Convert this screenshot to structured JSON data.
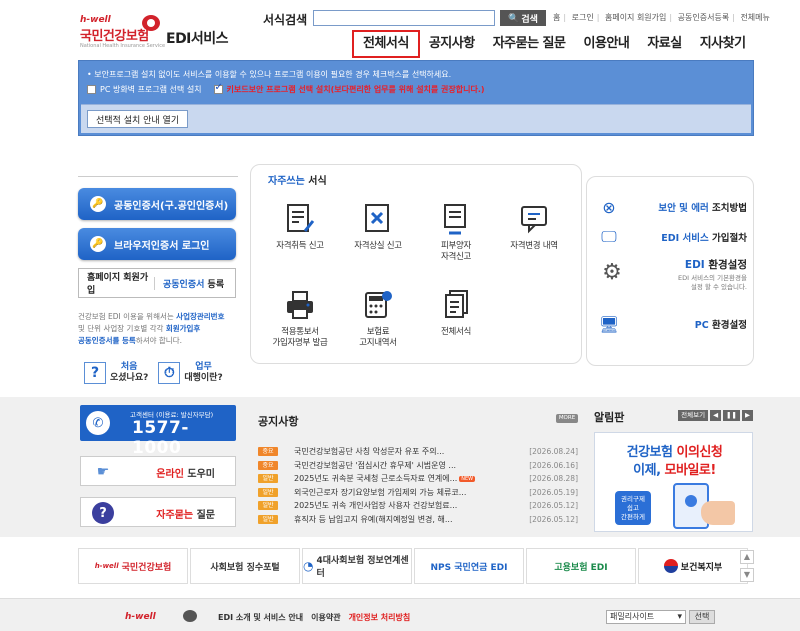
{
  "header": {
    "logo": {
      "brand": "h-well",
      "name": "국민건강보험",
      "sub": "National Health Insurance Service",
      "service": "EDI서비스"
    },
    "search": {
      "label": "서식검색",
      "value": "",
      "button": "검색"
    },
    "util_nav": [
      "홈",
      "로그인",
      "홈페이지 회원가입",
      "공동인증서등록",
      "전체메뉴"
    ],
    "gnb": [
      "전체서식",
      "공지사항",
      "자주묻는 질문",
      "이용안내",
      "자료실",
      "지사찾기"
    ]
  },
  "notice_box": {
    "line1": "• 보안프로그램 설치 없이도 서비스를 이용할 수 있으나 프로그램 이용이 필요한 경우 체크박스를 선택하세요.",
    "opt1": "PC 방화벽 프로그램 선택 설치",
    "opt2": "키보드보안 프로그램 선택 설치(보다편리한 업무를 위해 설치를 권장합니다.)",
    "open_button": "선택적 설치 안내 열기"
  },
  "left": {
    "cert_button": "공동인증서(구.공인인증서)",
    "browser_button": "브라우저인증서 로그인",
    "reg_a_bold": "홈페이지",
    "reg_a_rest": "회원가입",
    "reg_b_blue": "공동인증서",
    "reg_b_rest": "등록",
    "desc1": "건강보험 EDI 이용을 위해서는",
    "desc1b": "사업장관리번호",
    "desc2": "및 단위 사업장 기호별 각각",
    "desc2b": "회원가입후",
    "desc3b": "공동인증서를 등록",
    "desc3": "하셔야 합니다.",
    "quick1_a": "처음",
    "quick1_b": "오셨나요?",
    "quick2_a": "업무",
    "quick2_b": "대행이란?"
  },
  "forms": {
    "title_pre": "자주쓰는",
    "title": "서식",
    "items": [
      "자격취득 신고",
      "자격상실 신고",
      "피부양자\n자격신고",
      "자격변경 내역",
      "적용통보서\n가입자명부 발급",
      "보험료\n고지내역서",
      "전체서식"
    ]
  },
  "right": {
    "items": [
      {
        "a": "보안 및 에러",
        "b": "조치방법"
      },
      {
        "a": "EDI 서비스",
        "b": "가입절차"
      },
      {
        "a": "EDI",
        "b": "환경설정"
      },
      {
        "a": "PC",
        "b": "환경설정"
      }
    ],
    "env_desc": "EDI 서비스의 기본환경을\n설정 할 수 있습니다."
  },
  "callcenter": {
    "label": "고객센터 (이용료: 발신자부담)",
    "number": "1577-1000"
  },
  "side_buttons": {
    "online_a": "온라인",
    "online_b": "도우미",
    "faq_a": "자주묻는",
    "faq_b": "질문"
  },
  "notices": {
    "title": "공지사항",
    "more": "MORE",
    "rows": [
      {
        "tag": "중요",
        "color": "#f0862a",
        "title": "국민건강보험공단 사칭 악성문자 유포 주의...",
        "date": "[2026.08.24]",
        "new": false
      },
      {
        "tag": "중요",
        "color": "#f0862a",
        "title": "국민건강보험공단 '점심시간 휴무제' 시범운영 ...",
        "date": "[2026.06.16]",
        "new": false
      },
      {
        "tag": "일반",
        "color": "#f0862a",
        "title": "2025년도 귀속분 국세청 근로소득자료 연계에...",
        "date": "[2026.08.28]",
        "new": true
      },
      {
        "tag": "일반",
        "color": "#f0862a",
        "title": "외국인근로자 장기요양보험 가입제외 가능 체류코...",
        "date": "[2026.05.19]",
        "new": false
      },
      {
        "tag": "일반",
        "color": "#f0862a",
        "title": "2025년도 귀속 개인사업장 사용자 건강보험료...",
        "date": "[2026.05.12]",
        "new": false
      },
      {
        "tag": "일반",
        "color": "#f0862a",
        "title": "휴직자 등 납입고지 유예(해지예정일 변경, 해...",
        "date": "[2026.05.12]",
        "new": false
      }
    ]
  },
  "alarm": {
    "title": "알림판",
    "all_view": "전체보기",
    "banner_l1a": "건강보험",
    "banner_l1b": "이의신청",
    "banner_l2a": "이제,",
    "banner_l2b": "모바일로!",
    "banner_badge": "권리구제\n쉽고\n간편하게"
  },
  "partners": [
    {
      "text": "국민건강보험",
      "color": "#d2222b"
    },
    {
      "text": "사회보험 징수포털",
      "color": "#333"
    },
    {
      "text": "4대사회보험 정보연계센터",
      "color": "#333"
    },
    {
      "text": "NPS 국민연금 EDI",
      "color": "#1f63c6"
    },
    {
      "text": "고용보험 EDI",
      "color": "#1a8a4a"
    },
    {
      "text": "보건복지부",
      "color": "#222"
    }
  ],
  "footer": {
    "brand": "h-well",
    "links": [
      "EDI 소개 및 서비스 안내",
      "이용약관",
      "개인정보 처리방침"
    ],
    "family": "패밀리사이트",
    "go": "선택"
  }
}
